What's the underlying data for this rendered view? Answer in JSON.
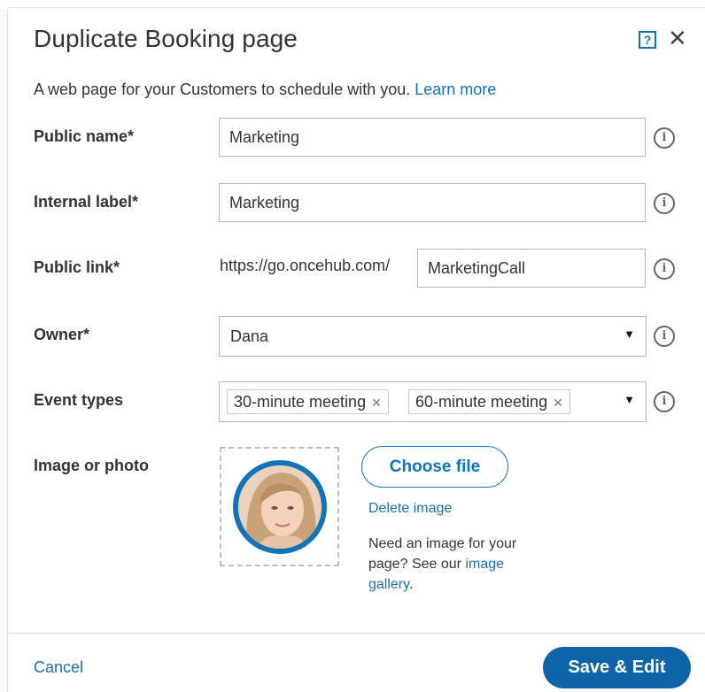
{
  "dialog": {
    "title": "Duplicate Booking page",
    "help_icon": "question-square-icon",
    "close_icon": "close-icon",
    "description": "A web page for your Customers to schedule with you.",
    "learn_more": "Learn more"
  },
  "fields": {
    "public_name": {
      "label": "Public name*",
      "value": "Marketing"
    },
    "internal_label": {
      "label": "Internal label*",
      "value": "Marketing"
    },
    "public_link": {
      "label": "Public link*",
      "prefix": "https://go.oncehub.com/",
      "value": "MarketingCall"
    },
    "owner": {
      "label": "Owner*",
      "value": "Dana"
    },
    "event_types": {
      "label": "Event types",
      "chips": [
        "30-minute meeting",
        "60-minute meeting"
      ]
    },
    "image": {
      "label": "Image or photo",
      "choose_file": "Choose file",
      "delete_image": "Delete image",
      "note": "Need an image for your page? See our",
      "gallery_link": "image gallery",
      "note_end": "."
    }
  },
  "footer": {
    "cancel": "Cancel",
    "save": "Save & Edit"
  },
  "colors": {
    "accent": "#0e74bc",
    "primary_button": "#0d65a8",
    "text": "#333333",
    "border": "#b5b5b5"
  }
}
